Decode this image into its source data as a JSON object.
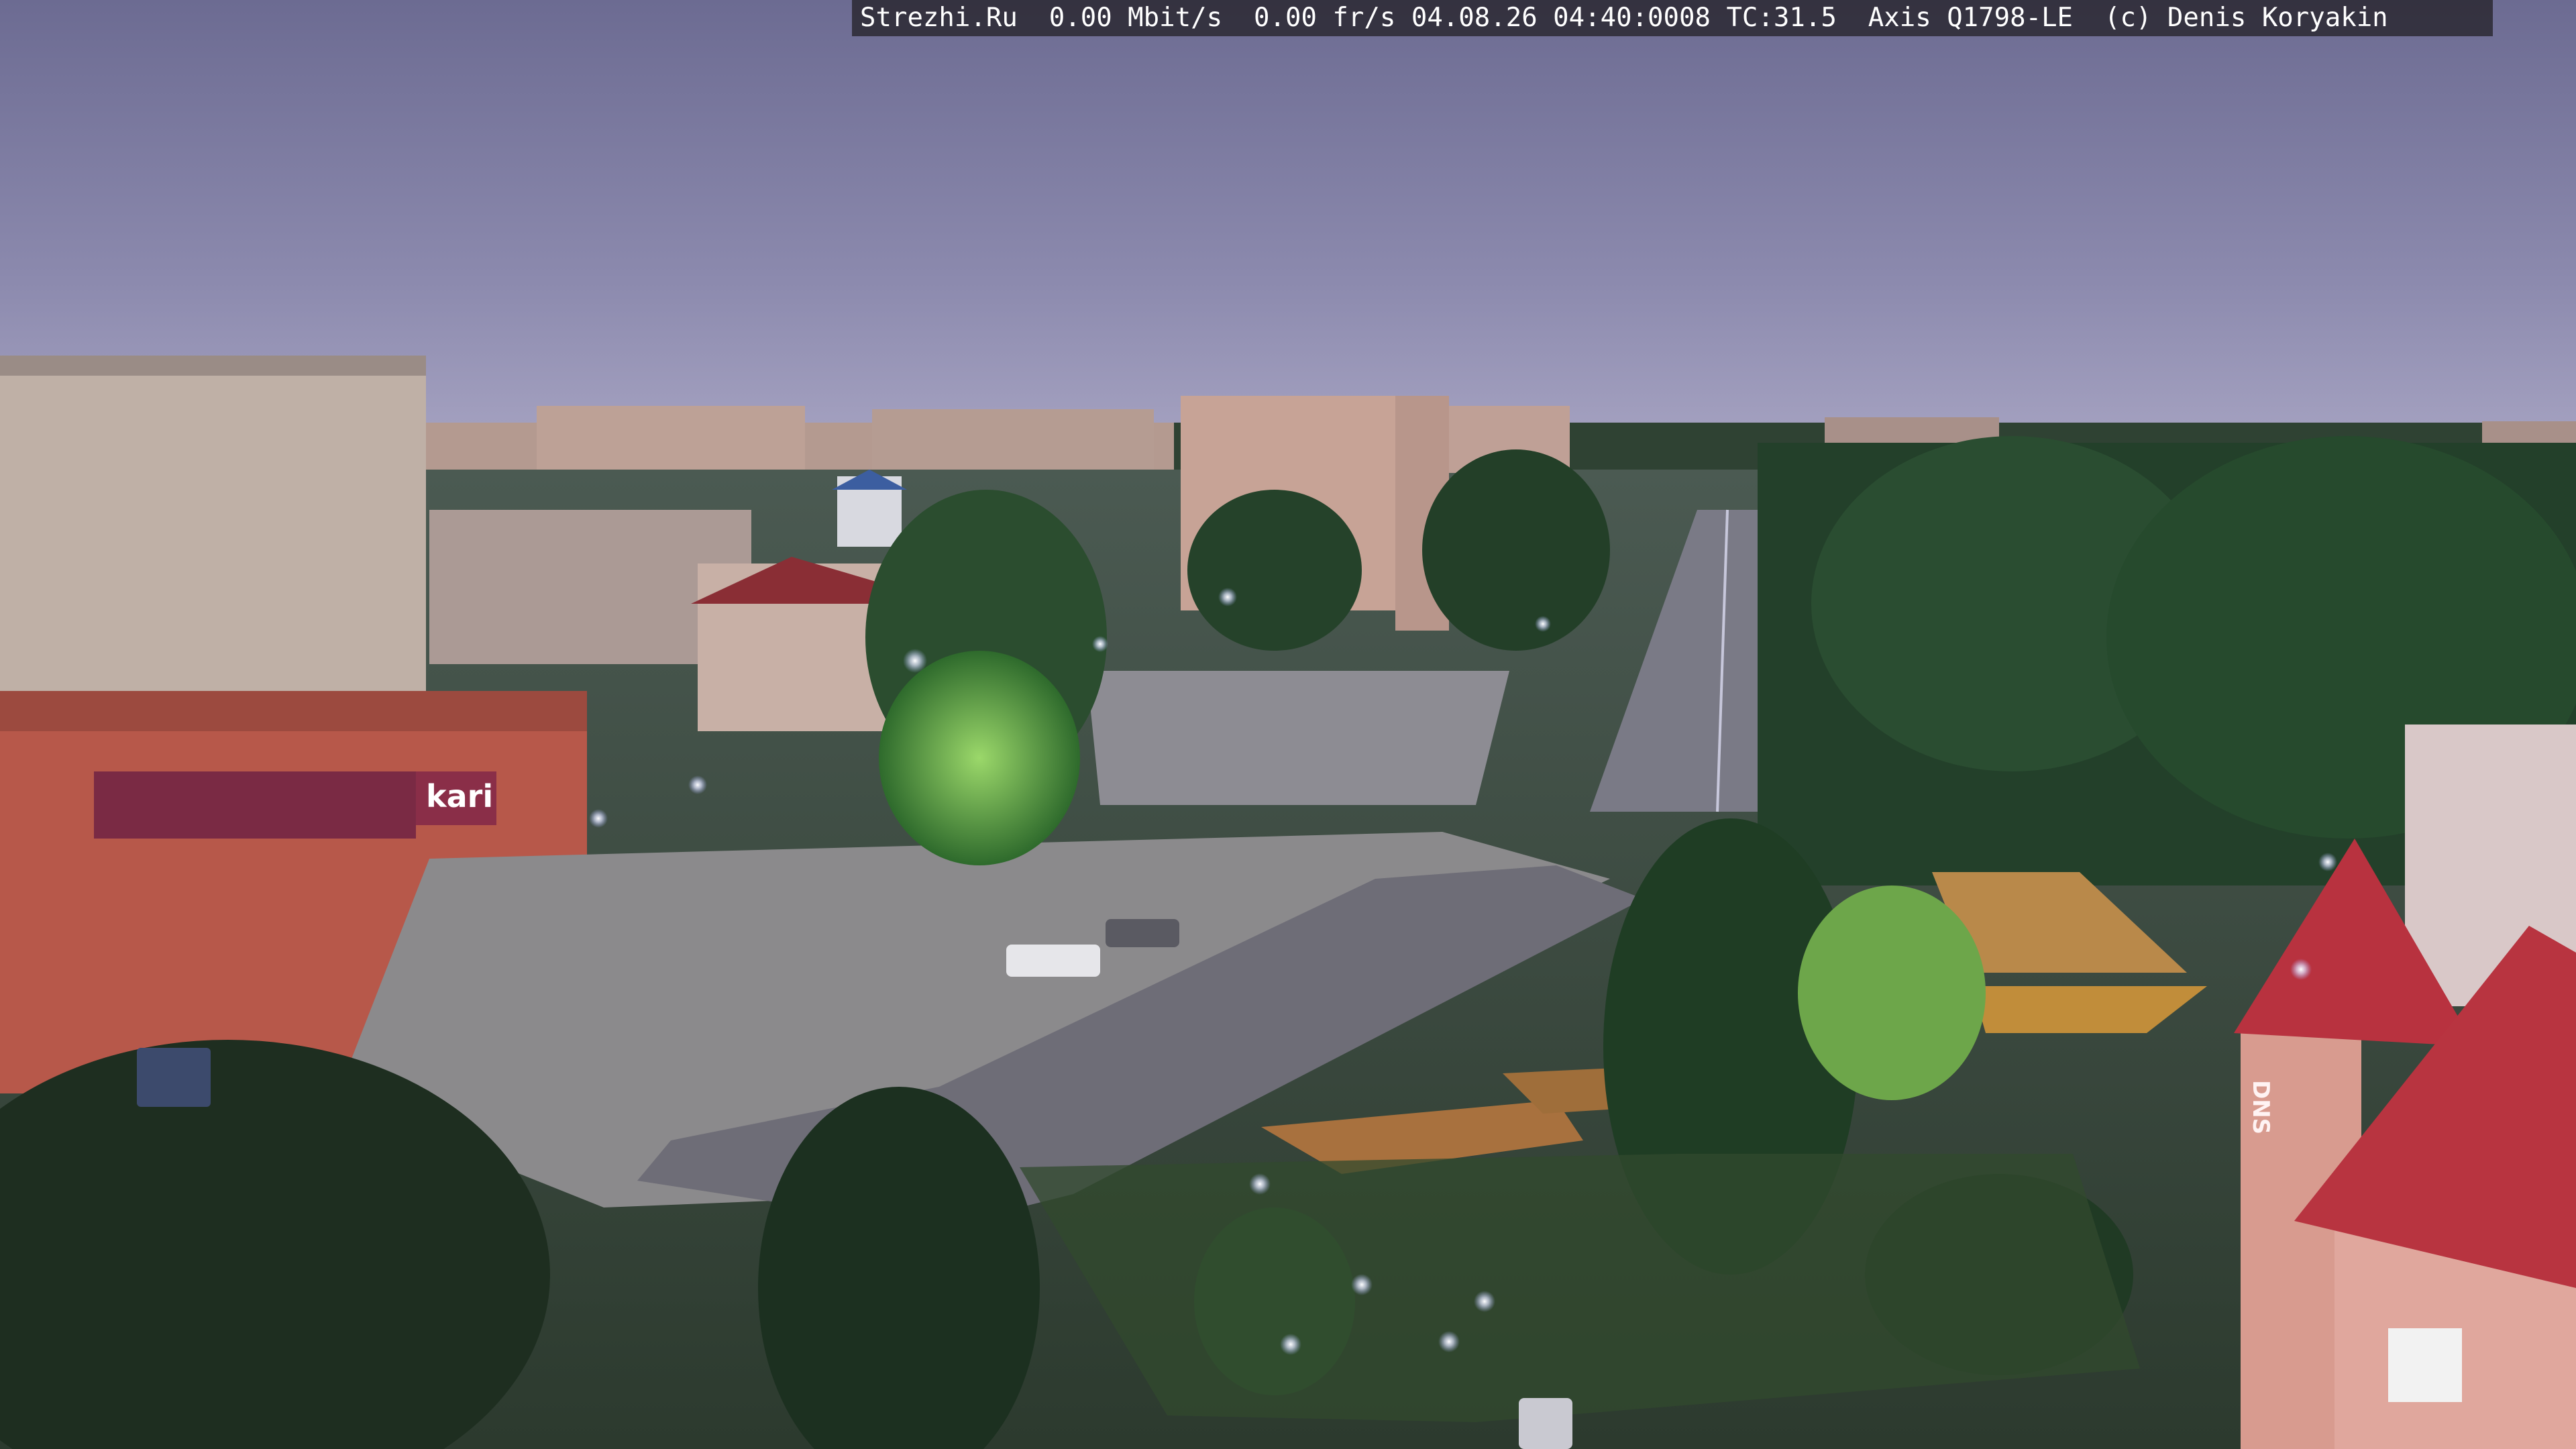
{
  "overlay": {
    "site": "Strezhi.Ru",
    "bitrate": "0.00 Mbit/s",
    "framerate": "0.00 fr/s",
    "datetime": "04.08.26 04:40:0008",
    "temperature": "TC:31.5",
    "camera_model": "Axis Q1798-LE",
    "copyright": "(c) Denis Koryakin"
  },
  "signs": {
    "store_brand": "kari",
    "corner_building": "DNS"
  },
  "colors": {
    "sky_top": "#6f6f95",
    "sky_horizon": "#a8a5c4",
    "tree_dark": "#1f3a24",
    "road": "#6b6b78",
    "street_light": "#e8eaff",
    "roof_red": "#b8323f"
  }
}
